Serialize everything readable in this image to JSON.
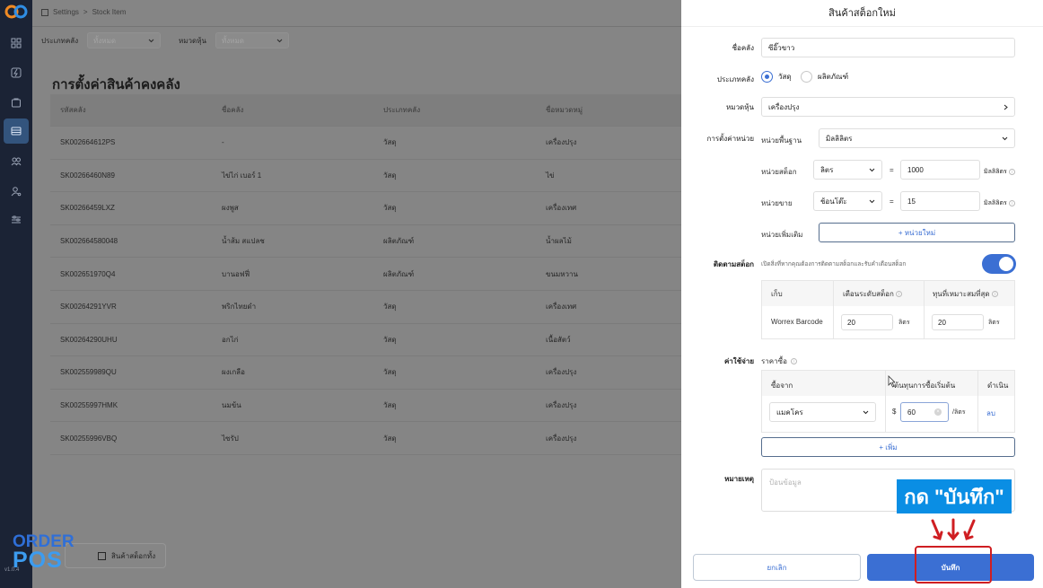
{
  "breadcrumb": {
    "root": "Settings",
    "sep": ">",
    "current": "Stock Item"
  },
  "filters": [
    {
      "label": "ประเภทคลัง",
      "value": "ทั้งหมด"
    },
    {
      "label": "หมวดหุ้น",
      "value": "ทั้งหมด"
    }
  ],
  "page_title": "การตั้งค่าสินค้าคงคลัง",
  "table": {
    "headers": [
      "รหัสคลัง",
      "ชื่อคลัง",
      "ประเภทคลัง",
      "ชื่อหมวดหมู่"
    ],
    "rows": [
      [
        "SK002664612PS",
        "-",
        "วัสดุ",
        "เครื่องปรุง"
      ],
      [
        "SK00266460N89",
        "ไข่ไก่ เบอร์ 1",
        "วัสดุ",
        "ไข่"
      ],
      [
        "SK00266459LXZ",
        "ผงพูส",
        "วัสดุ",
        "เครื่องเทศ"
      ],
      [
        "SK002664580048",
        "น้ำส้ม สแปลช",
        "ผลิตภัณฑ์",
        "น้ำผลไม้"
      ],
      [
        "SK002651970Q4",
        "บานอฟฟี่",
        "ผลิตภัณฑ์",
        "ขนมหวาน"
      ],
      [
        "SK00264291YVR",
        "พริกไทยดำ",
        "วัสดุ",
        "เครื่องเทศ"
      ],
      [
        "SK00264290UHU",
        "อกไก่",
        "วัสดุ",
        "เนื้อสัตว์"
      ],
      [
        "SK002559989QU",
        "ผงเกลือ",
        "วัสดุ",
        "เครื่องปรุง"
      ],
      [
        "SK00255997HMK",
        "นมข้น",
        "วัสดุ",
        "เครื่องปรุง"
      ],
      [
        "SK00255996VBQ",
        "ไซรัป",
        "วัสดุ",
        "เครื่องปรุง"
      ]
    ]
  },
  "all_stock_button": "สินค้าสต็อกทั้ง",
  "brand": {
    "line1": "ORDER",
    "line2": "POS"
  },
  "version": "v1.0.4",
  "panel": {
    "title": "สินค้าสต็อกใหม่",
    "name_label": "ชื่อคลัง",
    "name_value": "ซีอิ๊วขาว",
    "type_label": "ประเภทคลัง",
    "type_options": [
      "วัสดุ",
      "ผลิตภัณฑ์"
    ],
    "category_label": "หมวดหุ้น",
    "category_value": "เครื่องปรุง",
    "unit_label": "การตั้งค่าหน่วย",
    "base_unit_label": "หน่วยพื้นฐาน",
    "base_unit_value": "มิลลิลิตร",
    "stock_unit_label": "หน่วยสต็อก",
    "stock_unit_value": "ลิตร",
    "stock_unit_qty": "1000",
    "stock_unit_suffix": "มิลลิลิตร",
    "sell_unit_label": "หน่วยขาย",
    "sell_unit_value": "ช้อนโต๊ะ",
    "sell_unit_qty": "15",
    "sell_unit_suffix": "มิลลิลิตร",
    "extra_unit_label": "หน่วยเพิ่มเติม",
    "extra_unit_button": "+ หน่วยใหม่",
    "equals": "=",
    "tracking_label": "ติดตามสต็อก",
    "tracking_desc": "เปิดสิ่งที่หากคุณต้องการติดตามสต็อกและรับคำเตือนสต็อก",
    "tracking_headers": [
      "เก็บ",
      "เตือนระดับสต็อก",
      "ทุนที่เหมาะสมที่สุด"
    ],
    "tracking_row": {
      "store": "Worrex Barcode",
      "alert": "20",
      "alert_unit": "ลิตร",
      "optimal": "20",
      "optimal_unit": "ลิตร"
    },
    "cost_label": "ค่าใช้จ่าย",
    "cost_sub": "ราคาซื้อ",
    "cost_headers": [
      "ซื้อจาก",
      "ต้นทุนการซื้อเริ่มต้น",
      "ดำเนิน"
    ],
    "cost_row": {
      "supplier": "แมคโคร",
      "currency": "$",
      "price": "60",
      "per": "/ลิตร",
      "action": "ลบ"
    },
    "add_button": "+ เพิ่ม",
    "note_label": "หมายเหตุ",
    "note_placeholder": "ป้อนข้อมูล",
    "cancel": "ยกเลิก",
    "save": "บันทึก"
  },
  "callout": "กด \"บันทึก\""
}
